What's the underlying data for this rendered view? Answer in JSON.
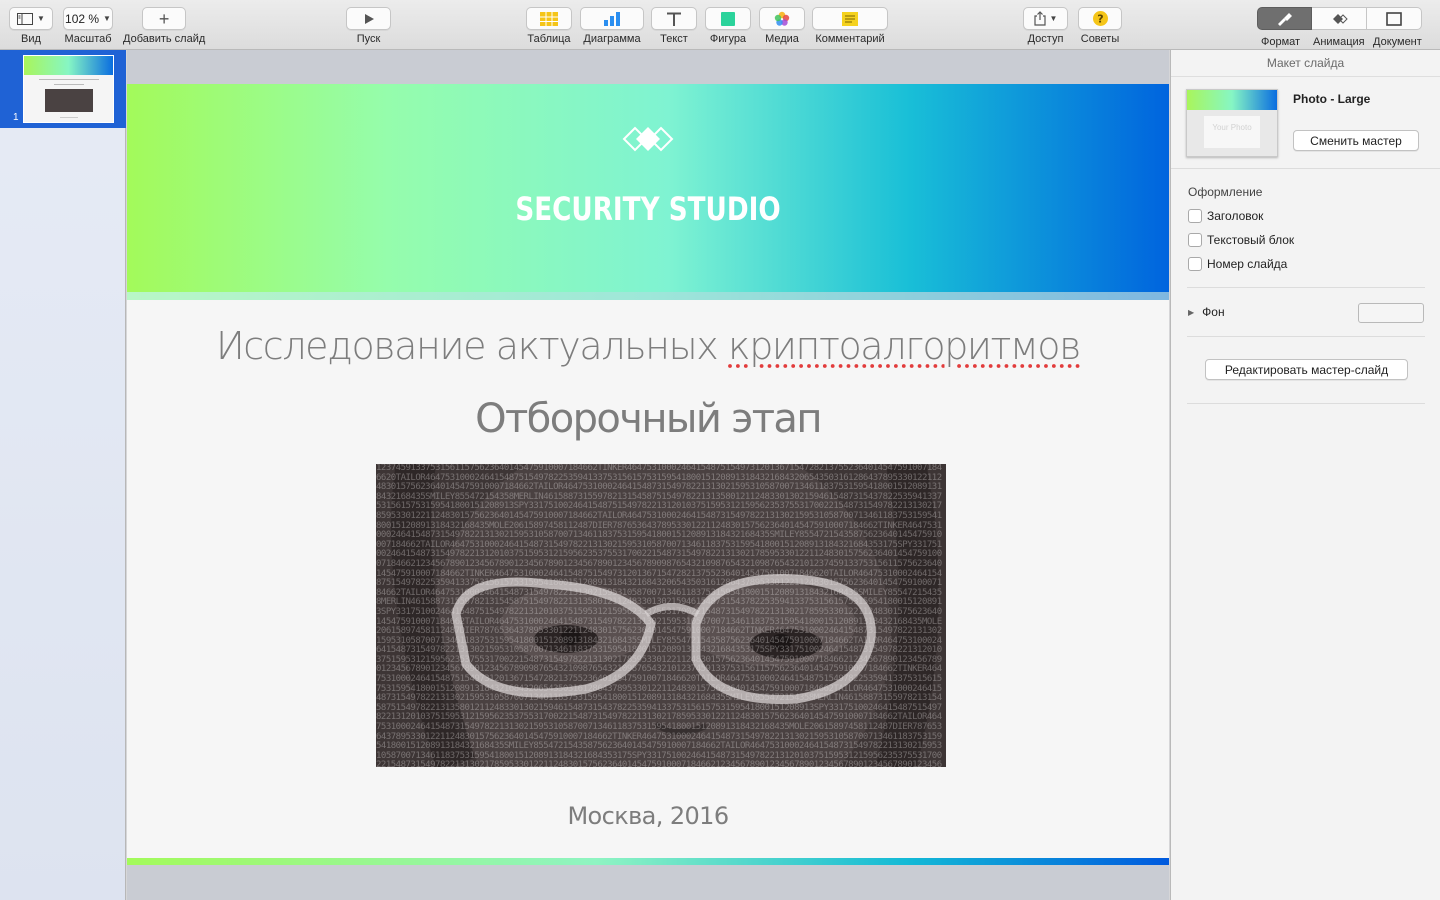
{
  "toolbar": {
    "view_label": "Вид",
    "zoom_value": "102 %",
    "zoom_label": "Масштаб",
    "add_slide_label": "Добавить слайд",
    "play_label": "Пуск",
    "table_label": "Таблица",
    "chart_label": "Диаграмма",
    "text_label": "Текст",
    "shape_label": "Фигура",
    "media_label": "Медиа",
    "comment_label": "Комментарий",
    "share_label": "Доступ",
    "tips_label": "Советы",
    "format_label": "Формат",
    "animate_label": "Анимация",
    "document_label": "Документ",
    "colors": {
      "table": "#f5c518",
      "chart": "#2a8ef0",
      "shape": "#2bd39b",
      "comment": "#f5d21e",
      "tips": "#f5c518"
    }
  },
  "navigator": {
    "slides": [
      {
        "number": "1"
      }
    ]
  },
  "slide": {
    "brand": "SECURITY STUDIO",
    "title_part1": "Исследование актуальных ",
    "title_part2": "криптоалгоритмов",
    "subtitle": "Отборочный этап",
    "footer": "Москва, 2016",
    "photo_text": "123745913375315611575623640145475910007184662TINKER46475310002464154875154973120136715472821375523640145475910071846620TAILOR46475310002464154875154978225359413375315615753159541800151208913184321684320654350316128643789533012211248301575623640145475910007184662TAILOR464753100024641548731549782213130215953105870071346118375315954180015120891318432168435SMILEY855472154358MERLIN4615887315597821315458751549782213135801211248330130215946154873154378225359413375315615753159541800151208913SPY331751002464154875154978221312010375159531215956235375531700221548731549782213130217859533012211248301575623640145475910007184662TAILOR464753100024641548731549782213130215953105870071346118375315954180015120891318432168435MOLE20615897458112487DIER787653643789533012211248301575623640145475910007184662TINKER464753100024641548731549782213130215953105870071346118375315954180015120891318432168435SMILEY85547215435875623640145475910007184662TAILOR4647531000246415487315497822131302159531058700713461183753159541800151208913184321684353175SPY33175100246415487315497822131201037515953121595623537553170022154873154978221313021785953301221124830157562364014547591000718466212345678901234567890123456789012345678901234567890987654321098765432109876543210"
  },
  "inspector": {
    "header": "Макет слайда",
    "master_name": "Photo - Large",
    "master_thumb_text": "Your Photo",
    "change_master_button": "Сменить мастер",
    "appearance_title": "Оформление",
    "checkboxes": [
      {
        "label": "Заголовок",
        "checked": false
      },
      {
        "label": "Текстовый блок",
        "checked": false
      },
      {
        "label": "Номер слайда",
        "checked": false
      }
    ],
    "background_label": "Фон",
    "edit_master_button": "Редактировать мастер-слайд"
  }
}
